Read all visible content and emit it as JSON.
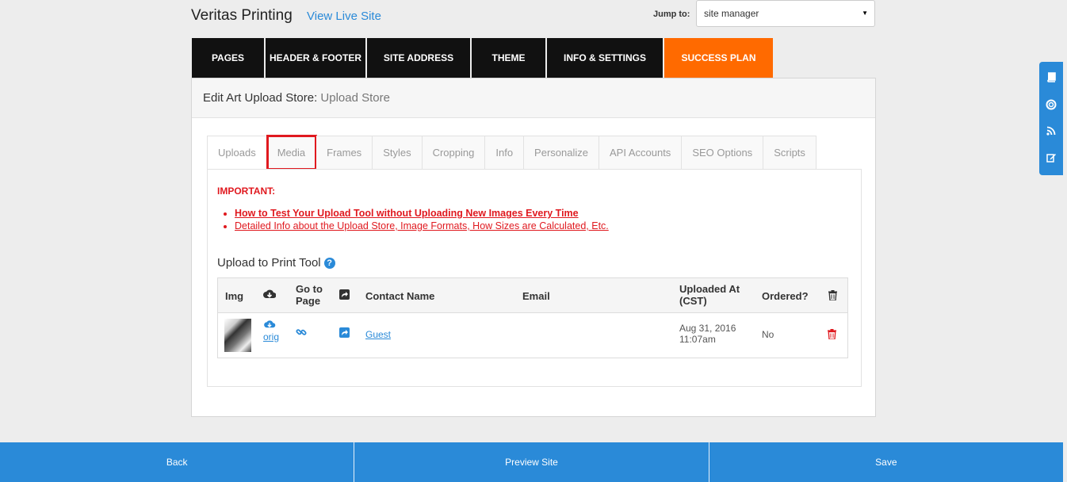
{
  "header": {
    "site_title": "Veritas Printing",
    "view_live": "View Live Site",
    "jump_label": "Jump to:",
    "jump_value": "site manager"
  },
  "nav": {
    "items": [
      "PAGES",
      "HEADER & FOOTER",
      "SITE ADDRESS",
      "THEME",
      "INFO & SETTINGS",
      "SUCCESS PLAN"
    ],
    "accent_color": "#ff6a00"
  },
  "panel": {
    "title": "Edit Art Upload Store:",
    "subtitle": "Upload Store"
  },
  "tabs": [
    "Uploads",
    "Media",
    "Frames",
    "Styles",
    "Cropping",
    "Info",
    "Personalize",
    "API Accounts",
    "SEO Options",
    "Scripts"
  ],
  "content": {
    "important": "IMPORTANT:",
    "link1": "How to Test Your Upload Tool without Uploading New Images Every Time",
    "link2": "Detailed Info about the Upload Store, Image Formats, How Sizes are Calculated, Etc.",
    "tool_title": "Upload to Print Tool",
    "help_glyph": "?"
  },
  "table": {
    "headers": {
      "img": "Img",
      "goto": "Go to Page",
      "contact": "Contact Name",
      "email": "Email",
      "uploaded": "Uploaded At (CST)",
      "ordered": "Ordered?"
    },
    "rows": [
      {
        "download": "orig",
        "contact": "Guest",
        "email": "",
        "uploaded": "Aug 31, 2016 11:07am",
        "ordered": "No"
      }
    ]
  },
  "footer": {
    "back": "Back",
    "preview": "Preview Site",
    "save": "Save"
  },
  "colors": {
    "primary": "#2a8ad8",
    "danger": "#e0191f",
    "nav_bg": "#111111"
  }
}
